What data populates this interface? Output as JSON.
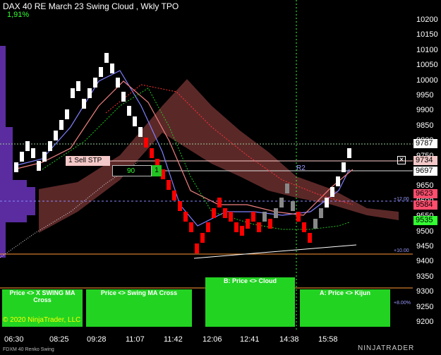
{
  "header": {
    "title": "DAX 40 RE March 23 Swing Cloud , Wkly TPO",
    "change": "1,91%"
  },
  "y_axis": [
    "10200",
    "10150",
    "10100",
    "10050",
    "10000",
    "9950",
    "9900",
    "9850",
    "9800",
    "9750",
    "9700",
    "9650",
    "9600",
    "9550",
    "9500",
    "9450",
    "9400",
    "9350",
    "9300",
    "9250",
    "9200"
  ],
  "x_axis": [
    "06:30",
    "08:25",
    "09:28",
    "11:07",
    "11:42",
    "12:06",
    "12:41",
    "14:38",
    "15:58"
  ],
  "price_flags": [
    {
      "label": "9787",
      "color": "#ffffff"
    },
    {
      "label": "9734",
      "color": "#f4c8c8"
    },
    {
      "label": "9697",
      "color": "#ffffff"
    },
    {
      "label": "9623",
      "color": "#ff4d6d"
    },
    {
      "label": "9584",
      "color": "#ff4d6d"
    },
    {
      "label": "9535",
      "color": "#33ff33"
    }
  ],
  "order": {
    "sell_label": "1  Sell STP",
    "qty": "90",
    "count": "1"
  },
  "panels": [
    {
      "line1": "Price <> X SWING MA",
      "line2": "Cross"
    },
    {
      "line1": "Price <> Swing MA Cross",
      "line2": ""
    },
    {
      "line1": "B: Price <> Cloud",
      "line2": ""
    },
    {
      "line1": "A: Price <> Kijun",
      "line2": ""
    }
  ],
  "annotations": {
    "r2": "R2",
    "p12": "+12.00",
    "p10": "+10.00",
    "p8": "+8.00%"
  },
  "copyright": "© 2020 NinjaTrader, LLC",
  "footer": "FDXM 40 Renko Swing",
  "brand": "NINJATRADER",
  "icons": {
    "close": "close-order-icon"
  }
}
